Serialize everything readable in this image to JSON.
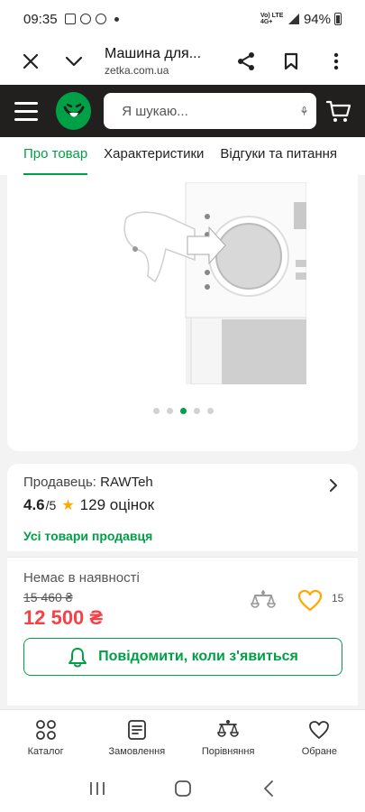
{
  "status_bar": {
    "time": "09:35",
    "battery": "94%",
    "network": "Vo) LTE 4G+"
  },
  "browser": {
    "title": "Машина для...",
    "url": "zetka.com.ua"
  },
  "search": {
    "placeholder": "Я шукаю..."
  },
  "tabs": [
    {
      "label": "Про товар",
      "active": true
    },
    {
      "label": "Характеристики",
      "active": false
    },
    {
      "label": "Відгуки та питання",
      "active": false
    }
  ],
  "gallery": {
    "dots": 5,
    "active_index": 2
  },
  "seller": {
    "label": "Продавець:",
    "name": "RAWTeh",
    "rating": "4.6",
    "rating_out_of": "/5",
    "reviews": "129 оцінок",
    "all_goods": "Усі товари продавця"
  },
  "buy": {
    "stock": "Немає в наявності",
    "old_price": "15 460 ₴",
    "price": "12 500 ₴",
    "favorites_count": "15",
    "notify_label": "Повідомити, коли з'явиться"
  },
  "bottom_nav": [
    {
      "label": "Каталог",
      "icon": "catalog-icon"
    },
    {
      "label": "Замовлення",
      "icon": "orders-icon"
    },
    {
      "label": "Порівняння",
      "icon": "compare-icon"
    },
    {
      "label": "Обране",
      "icon": "heart-icon"
    }
  ],
  "colors": {
    "accent": "#00a046",
    "price": "#f84147",
    "header": "#221f1f",
    "star": "#ffa900"
  }
}
